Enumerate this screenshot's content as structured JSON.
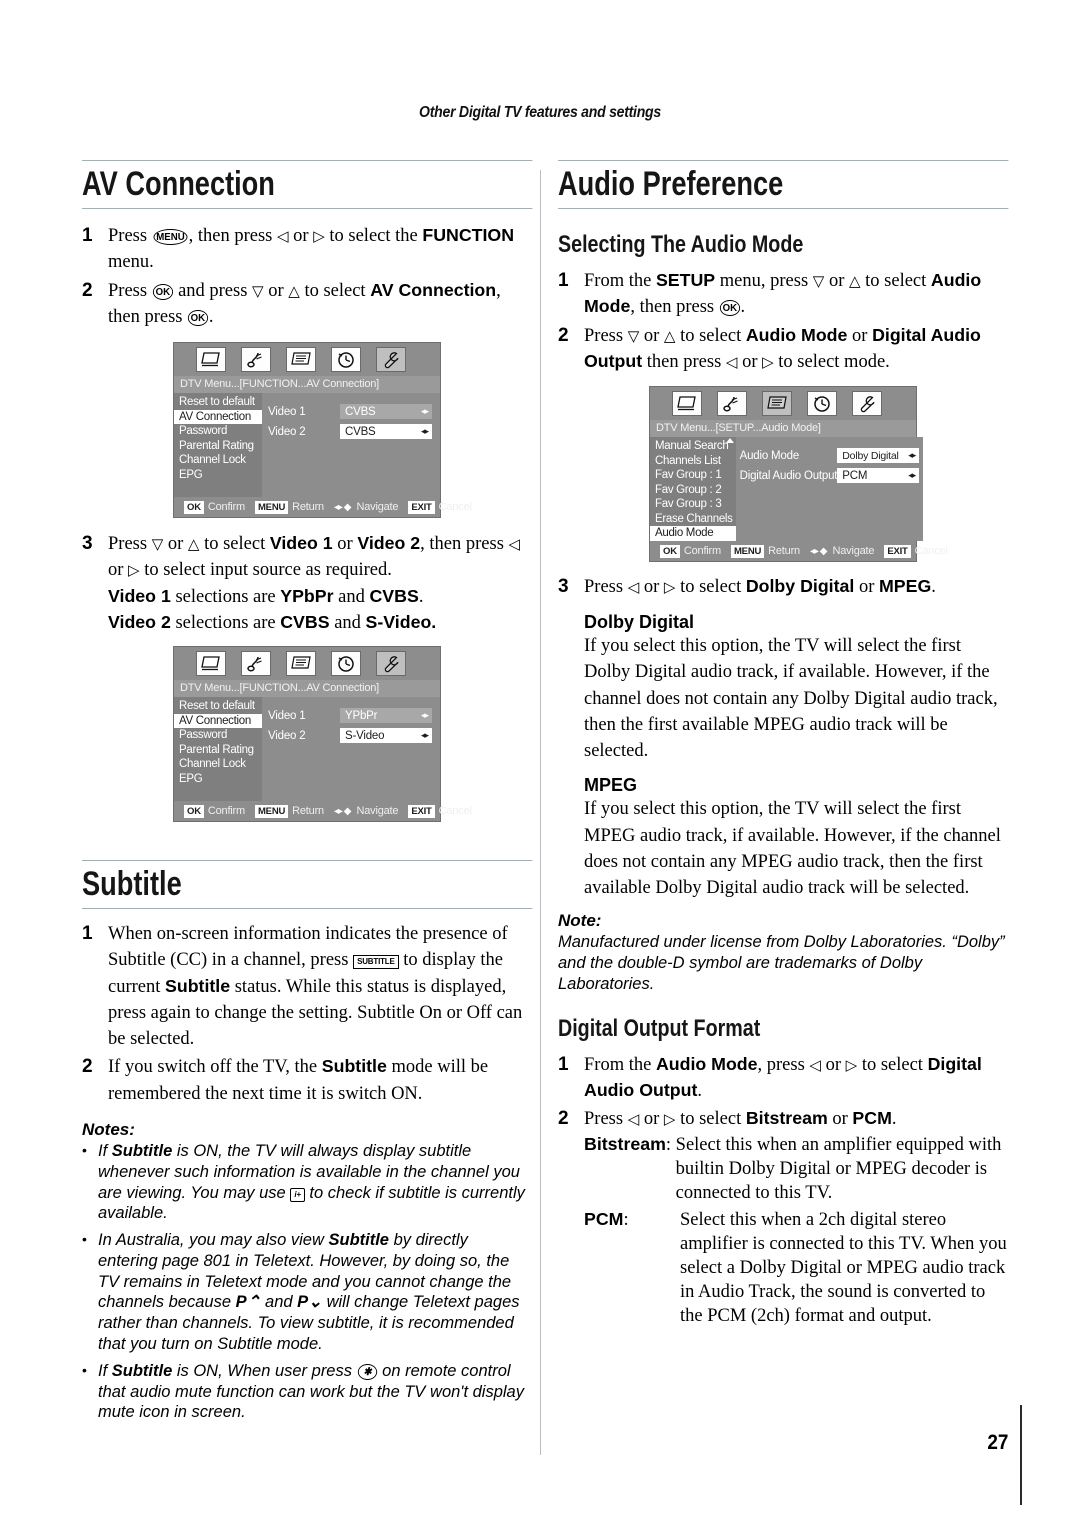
{
  "running_head": "Other Digital TV features and settings",
  "page_number": "27",
  "left_column": {
    "section_title": "AV Connection",
    "steps": [
      {
        "num": "1",
        "html": "Press <span class=\"key\">MENU</span>, then press <span class=\"tri\">&#9665;</span> or <span class=\"tri\">&#9655;</span> to select the <b>FUNCTION</b> menu."
      },
      {
        "num": "2",
        "html": "Press <span class=\"key\">OK</span> and press <span class=\"tri\">&#9661;</span> or <span class=\"tri\">&#9651;</span> to select <b>AV Connection</b>, then press <span class=\"key\">OK</span>."
      },
      {
        "num": "3",
        "html": "Press <span class=\"tri\">&#9661;</span> or <span class=\"tri\">&#9651;</span> to select <b>Video 1</b> or <b>Video 2</b>, then press <span class=\"tri\">&#9665;</span> or <span class=\"tri\">&#9655;</span> to select input source as required.<br><b>Video 1</b> selections are <b>YPbPr</b> and <b>CVBS</b>.<br><b>Video 2</b> selections are <b>CVBS</b> and <b>S-Video.</b>"
      }
    ],
    "osd_1": {
      "path": "DTV Menu...[FUNCTION...AV Connection]",
      "menu_items": [
        "Reset to default",
        "AV Connection",
        "Password",
        "Parental Rating",
        "Channel Lock",
        "EPG"
      ],
      "highlighted_item": "AV Connection",
      "fields": [
        {
          "label": "Video 1",
          "value": "CVBS",
          "style": "grey"
        },
        {
          "label": "Video 2",
          "value": "CVBS",
          "style": "white"
        }
      ],
      "selected_tab": 4
    },
    "osd_2": {
      "path": "DTV Menu...[FUNCTION...AV Connection]",
      "menu_items": [
        "Reset to default",
        "AV Connection",
        "Password",
        "Parental Rating",
        "Channel Lock",
        "EPG"
      ],
      "highlighted_item": "AV Connection",
      "fields": [
        {
          "label": "Video 1",
          "value": "YPbPr",
          "style": "grey"
        },
        {
          "label": "Video 2",
          "value": "S-Video",
          "style": "white"
        }
      ],
      "selected_tab": 4
    },
    "subtitle_section": {
      "title": "Subtitle",
      "steps": [
        {
          "num": "1",
          "html": "When on-screen information indicates the presence of Subtitle (CC) in a channel, press <span class=\"keyrect\">SUBTITLE</span> to display the current <b>Subtitle</b> status. While this status is displayed, press again to change the setting. Subtitle On or Off can be selected."
        },
        {
          "num": "2",
          "html": "If you switch off the TV, the <b>Subtitle</b> mode will be remembered the next time it is switch ON."
        }
      ],
      "notes_title": "Notes:",
      "notes": [
        "If <b>Subtitle</b> is ON, the TV will always display subtitle whenever such information is available in the channel you are viewing. You may use <span class=\"keyrect\" style=\"border-radius:2px\">i+</span> to check if subtitle is currently available.",
        "In Australia, you may also view <b>Subtitle</b> by directly entering page 801 in Teletext. However, by doing so, the TV remains in Teletext mode and you cannot change the channels because <b>P&#8963;</b> and <b>P&#8964;</b> will change Teletext pages rather than channels. To view subtitle, it is recommended that you turn on Subtitle mode.",
        "If <b>Subtitle</b> is ON, When user press <span class=\"key\">&#10033;</span> on remote control that audio mute function can work but the TV won't display mute icon in screen."
      ]
    }
  },
  "right_column": {
    "section_title": "Audio Preference",
    "sub_title_1": "Selecting The Audio Mode",
    "steps_1": [
      {
        "num": "1",
        "html": "From the <b>SETUP</b> menu, press <span class=\"tri\">&#9661;</span> or <span class=\"tri\">&#9651;</span> to select <b>Audio Mode</b>, then press <span class=\"key\">OK</span>."
      },
      {
        "num": "2",
        "html": "Press <span class=\"tri\">&#9661;</span> or <span class=\"tri\">&#9651;</span> to select <b>Audio Mode</b> or <b>Digital Audio Output</b> then press <span class=\"tri\">&#9665;</span> or <span class=\"tri\">&#9655;</span> to select mode."
      }
    ],
    "osd_3": {
      "path": "DTV Menu...[SETUP...Audio Mode]",
      "menu_items": [
        "Manual Search",
        "Channels List",
        "Fav Group : 1",
        "Fav Group : 2",
        "Fav Group : 3",
        "Erase Channels",
        "Audio Mode"
      ],
      "highlighted_item": "Audio Mode",
      "fields": [
        {
          "label": "Audio Mode",
          "value": "Dolby Digital",
          "style": "white"
        },
        {
          "label": "Digital Audio Output",
          "value": "PCM",
          "style": "white"
        }
      ],
      "selected_tab": 2
    },
    "step_3": {
      "num": "3",
      "html": "Press <span class=\"tri\">&#9665;</span> or <span class=\"tri\">&#9655;</span> to select <b>Dolby Digital</b> or <b>MPEG</b>."
    },
    "definitions": [
      {
        "head": "Dolby Digital",
        "text": "If you select this option, the TV will select the first Dolby Digital audio track, if available. However, if the channel does not contain any Dolby Digital audio track, then the first available MPEG audio track will be selected."
      },
      {
        "head": "MPEG",
        "text": "If you select this option, the TV will select the first MPEG audio track, if available. However, if the channel does not contain any MPEG audio track, then the first available Dolby Digital audio track will be selected."
      }
    ],
    "note_title": "Note:",
    "note_text": "Manufactured under license from Dolby Laboratories. “Dolby” and the double-D symbol are trademarks of Dolby Laboratories.",
    "sub_title_2": "Digital Output Format",
    "steps_2": [
      {
        "num": "1",
        "html": "From the <b>Audio Mode</b>, press <span class=\"tri\">&#9665;</span> or <span class=\"tri\">&#9655;</span> to select <b>Digital Audio Output</b>."
      },
      {
        "num": "2",
        "html": "Press <span class=\"tri\">&#9665;</span> or <span class=\"tri\">&#9655;</span> to select <b>Bitstream</b> or <b>PCM</b>."
      }
    ],
    "definitions_2": [
      {
        "label": "Bitstream",
        "label_suffix": ":",
        "text": "Select this when an amplifier equipped with builtin Dolby Digital or MPEG decoder is connected to this TV."
      },
      {
        "label": "PCM",
        "label_suffix": ":",
        "text": "Select this when a 2ch digital stereo amplifier is connected to this TV. When you select a Dolby Digital or MPEG audio track in Audio Track, the sound is converted to the PCM (2ch) format and output."
      }
    ]
  },
  "osd_footer": {
    "ok_chip": "OK",
    "ok_label": "Confirm",
    "menu_chip": "MENU",
    "menu_label": "Return",
    "nav_label": "Navigate",
    "exit_chip": "EXIT",
    "exit_label": "Cancel"
  },
  "colors": {
    "rule": "#9fb2ba",
    "divider": "#b8bcc6",
    "osd_bg": "#8d8d8d",
    "osd_list": "#7f7f7f"
  }
}
